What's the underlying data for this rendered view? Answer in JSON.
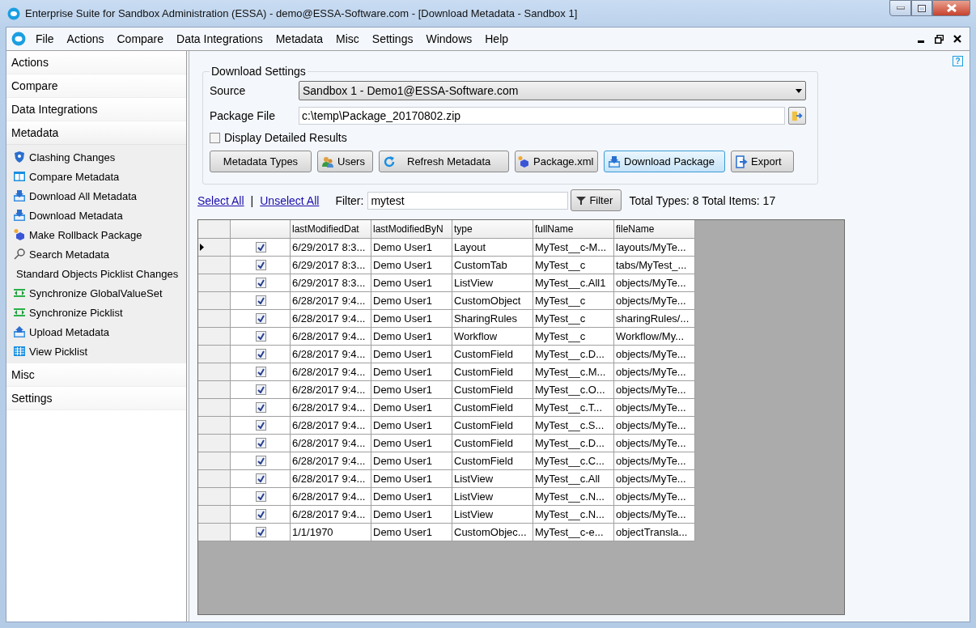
{
  "window": {
    "title": "Enterprise Suite for Sandbox Administration (ESSA) - demo@ESSA-Software.com - [Download Metadata - Sandbox 1]"
  },
  "menu": [
    "File",
    "Actions",
    "Compare",
    "Data Integrations",
    "Metadata",
    "Misc",
    "Settings",
    "Windows",
    "Help"
  ],
  "sidebar": {
    "sections": [
      {
        "label": "Actions",
        "expanded": false
      },
      {
        "label": "Compare",
        "expanded": false
      },
      {
        "label": "Data Integrations",
        "expanded": false
      },
      {
        "label": "Metadata",
        "expanded": true,
        "items": [
          "Clashing Changes",
          "Compare Metadata",
          "Download All Metadata",
          "Download Metadata",
          "Make Rollback Package",
          "Search Metadata",
          "Standard Objects Picklist Changes",
          "Synchronize GlobalValueSet",
          "Synchronize Picklist",
          "Upload Metadata",
          "View Picklist"
        ]
      },
      {
        "label": "Misc",
        "expanded": false
      },
      {
        "label": "Settings",
        "expanded": false
      }
    ]
  },
  "help_button": "?",
  "download_settings": {
    "title": "Download Settings",
    "source": {
      "label": "Source",
      "value": "Sandbox 1 - Demo1@ESSA-Software.com"
    },
    "package_file": {
      "label": "Package File",
      "value": "c:\\temp\\Package_20170802.zip"
    },
    "detailed_results": {
      "label": "Display Detailed Results",
      "checked": false
    },
    "buttons": [
      {
        "label": "Metadata Types",
        "focused": false
      },
      {
        "label": "Users",
        "focused": false
      },
      {
        "label": "Refresh Metadata",
        "focused": false
      },
      {
        "label": "Package.xml",
        "focused": false
      },
      {
        "label": "Download Package",
        "focused": true
      },
      {
        "label": "Export",
        "focused": false
      }
    ]
  },
  "filter_bar": {
    "select_all": "Select All",
    "separator": "|",
    "unselect_all": "Unselect All",
    "filter_label": "Filter:",
    "filter_value": "mytest",
    "filter_button": "Filter",
    "totals": "Total Types: 8 Total Items: 17"
  },
  "table": {
    "columns": [
      "lastModifiedDat",
      "lastModifiedByN",
      "type",
      "fullName",
      "fileName"
    ],
    "rows": [
      {
        "selected": true,
        "checked": true,
        "cells": [
          "6/29/2017 8:3...",
          "Demo User1",
          "Layout",
          "MyTest__c-M...",
          "layouts/MyTe..."
        ]
      },
      {
        "selected": false,
        "checked": true,
        "cells": [
          "6/29/2017 8:3...",
          "Demo User1",
          "CustomTab",
          "MyTest__c",
          "tabs/MyTest_..."
        ]
      },
      {
        "selected": false,
        "checked": true,
        "cells": [
          "6/29/2017 8:3...",
          "Demo User1",
          "ListView",
          "MyTest__c.All1",
          "objects/MyTe..."
        ]
      },
      {
        "selected": false,
        "checked": true,
        "cells": [
          "6/28/2017 9:4...",
          "Demo User1",
          "CustomObject",
          "MyTest__c",
          "objects/MyTe..."
        ]
      },
      {
        "selected": false,
        "checked": true,
        "cells": [
          "6/28/2017 9:4...",
          "Demo User1",
          "SharingRules",
          "MyTest__c",
          "sharingRules/..."
        ]
      },
      {
        "selected": false,
        "checked": true,
        "cells": [
          "6/28/2017 9:4...",
          "Demo User1",
          "Workflow",
          "MyTest__c",
          "Workflow/My..."
        ]
      },
      {
        "selected": false,
        "checked": true,
        "cells": [
          "6/28/2017 9:4...",
          "Demo User1",
          "CustomField",
          "MyTest__c.D...",
          "objects/MyTe..."
        ]
      },
      {
        "selected": false,
        "checked": true,
        "cells": [
          "6/28/2017 9:4...",
          "Demo User1",
          "CustomField",
          "MyTest__c.M...",
          "objects/MyTe..."
        ]
      },
      {
        "selected": false,
        "checked": true,
        "cells": [
          "6/28/2017 9:4...",
          "Demo User1",
          "CustomField",
          "MyTest__c.O...",
          "objects/MyTe..."
        ]
      },
      {
        "selected": false,
        "checked": true,
        "cells": [
          "6/28/2017 9:4...",
          "Demo User1",
          "CustomField",
          "MyTest__c.T...",
          "objects/MyTe..."
        ]
      },
      {
        "selected": false,
        "checked": true,
        "cells": [
          "6/28/2017 9:4...",
          "Demo User1",
          "CustomField",
          "MyTest__c.S...",
          "objects/MyTe..."
        ]
      },
      {
        "selected": false,
        "checked": true,
        "cells": [
          "6/28/2017 9:4...",
          "Demo User1",
          "CustomField",
          "MyTest__c.D...",
          "objects/MyTe..."
        ]
      },
      {
        "selected": false,
        "checked": true,
        "cells": [
          "6/28/2017 9:4...",
          "Demo User1",
          "CustomField",
          "MyTest__c.C...",
          "objects/MyTe..."
        ]
      },
      {
        "selected": false,
        "checked": true,
        "cells": [
          "6/28/2017 9:4...",
          "Demo User1",
          "ListView",
          "MyTest__c.All",
          "objects/MyTe..."
        ]
      },
      {
        "selected": false,
        "checked": true,
        "cells": [
          "6/28/2017 9:4...",
          "Demo User1",
          "ListView",
          "MyTest__c.N...",
          "objects/MyTe..."
        ]
      },
      {
        "selected": false,
        "checked": true,
        "cells": [
          "6/28/2017 9:4...",
          "Demo User1",
          "ListView",
          "MyTest__c.N...",
          "objects/MyTe..."
        ]
      },
      {
        "selected": false,
        "checked": true,
        "cells": [
          "1/1/1970",
          "Demo User1",
          "CustomObjec...",
          "MyTest__c-e...",
          "objectTransla..."
        ]
      }
    ]
  }
}
